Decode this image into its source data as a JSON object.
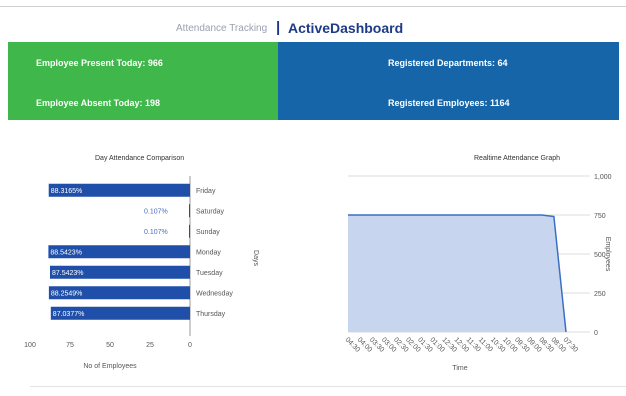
{
  "header": {
    "title": "ActiveDashboard",
    "separator": "|",
    "subtitle": "Attendance Tracking"
  },
  "stats": {
    "present": "Employee Present Today: 966",
    "absent": "Employee Absent Today: 198",
    "departments": "Registered Departments: 64",
    "employees": "Registered Employees: 1164"
  },
  "colors": {
    "green": "#3fb74a",
    "blue": "#1565a8",
    "bar": "#1f4fa8",
    "area_fill": "#c7d6ee",
    "area_line": "#3a6fc4"
  },
  "chart_data": [
    {
      "type": "bar",
      "title": "Day Attendance Comparison",
      "orientation": "horizontal",
      "categories": [
        "Friday",
        "Saturday",
        "Sunday",
        "Monday",
        "Tuesday",
        "Wednesday",
        "Thursday"
      ],
      "values": [
        88.3,
        0.1,
        0.1,
        88.5,
        87.5,
        88.2,
        87.0
      ],
      "data_labels": [
        "88.3165%",
        "0.107%",
        "0.107%",
        "88.5423%",
        "87.5423%",
        "88.2549%",
        "87.0377%"
      ],
      "xlabel": "No of Employees",
      "ylabel": "Days",
      "xlim": [
        0,
        100
      ],
      "x_ticks": [
        "0",
        "25",
        "50",
        "75",
        "100"
      ]
    },
    {
      "type": "area",
      "title": "Realtime Attendance Graph",
      "x": [
        "07:30",
        "08:00",
        "08:30",
        "09:00",
        "09:30",
        "10:00",
        "10:30",
        "11:00",
        "11:30",
        "12:00",
        "12:30",
        "01:00",
        "01:30",
        "02:00",
        "02:30",
        "03:00",
        "03:30",
        "04:00",
        "04:30"
      ],
      "values": [
        0,
        740,
        750,
        750,
        750,
        750,
        750,
        750,
        750,
        750,
        750,
        750,
        750,
        750,
        750,
        750,
        750,
        750,
        750
      ],
      "xlabel": "Time",
      "ylabel": "Employees",
      "ylim": [
        0,
        1000
      ],
      "y_ticks": [
        "0",
        "250",
        "500",
        "750",
        "1,000"
      ]
    }
  ]
}
